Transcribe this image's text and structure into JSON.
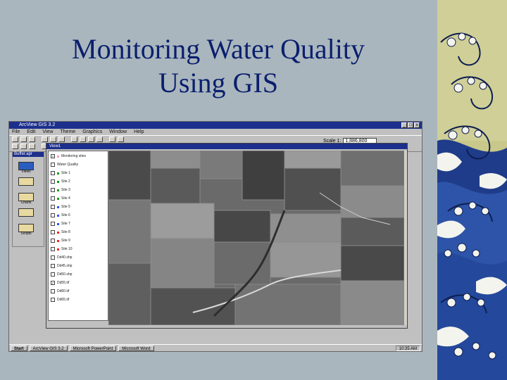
{
  "slide": {
    "title_line1": "Monitoring Water Quality",
    "title_line2": "Using GIS"
  },
  "screenshot": {
    "window_title": "ArcView GIS 3.2",
    "menu": [
      "File",
      "Edit",
      "View",
      "Theme",
      "Graphics",
      "Window",
      "Help"
    ],
    "scale_label": "Scale 1:",
    "scale_value": "1,886,800",
    "project_window": {
      "title": "Buffer.apr",
      "icons": [
        {
          "label": "Views",
          "icon": "views-icon",
          "selected": true
        },
        {
          "label": "",
          "icon": "tables-icon",
          "selected": false
        },
        {
          "label": "Charts",
          "icon": "charts-icon",
          "selected": false
        },
        {
          "label": "",
          "icon": "layouts-icon",
          "selected": false
        },
        {
          "label": "Scripts",
          "icon": "scripts-icon",
          "selected": false
        }
      ]
    },
    "view_window": {
      "title": "View1",
      "toc_themes": [
        {
          "label": "Monitoring sites",
          "checked": true,
          "swatch": "#ff99cc"
        },
        {
          "label": "Water Quality",
          "checked": false,
          "swatch": ""
        },
        {
          "label": "Site 1",
          "checked": false,
          "swatch": "#00a000"
        },
        {
          "label": "Site 2",
          "checked": false,
          "swatch": "#00a000"
        },
        {
          "label": "Site 3",
          "checked": false,
          "swatch": "#00a000"
        },
        {
          "label": "Site 4",
          "checked": false,
          "swatch": "#00a000"
        },
        {
          "label": "Site 5",
          "checked": false,
          "swatch": "#3050ff"
        },
        {
          "label": "Site 6",
          "checked": false,
          "swatch": "#3050ff"
        },
        {
          "label": "Site 7",
          "checked": false,
          "swatch": "#3050ff"
        },
        {
          "label": "Site 8",
          "checked": false,
          "swatch": "#ff2020"
        },
        {
          "label": "Site 9",
          "checked": false,
          "swatch": "#ff2020"
        },
        {
          "label": "Site 10",
          "checked": false,
          "swatch": "#ff2020"
        },
        {
          "label": "Dd40.shp",
          "checked": false,
          "swatch": ""
        },
        {
          "label": "Dd45.shp",
          "checked": false,
          "swatch": ""
        },
        {
          "label": "Dd50.shp",
          "checked": false,
          "swatch": ""
        },
        {
          "label": "Dd55.tif",
          "checked": true,
          "swatch": ""
        },
        {
          "label": "Dd60.tif",
          "checked": false,
          "swatch": ""
        },
        {
          "label": "Dd65.tif",
          "checked": false,
          "swatch": ""
        }
      ]
    },
    "taskbar": {
      "start_label": "Start",
      "tasks": [
        "ArcView GIS 3.2",
        "Microsoft PowerPoint",
        "Microsoft Word"
      ],
      "clock": "10:35 AM"
    }
  },
  "colors": {
    "slide_background": "#a9b6bd",
    "title_color": "#0b1f6e",
    "titlebar_blue": "#1c2f8c"
  }
}
